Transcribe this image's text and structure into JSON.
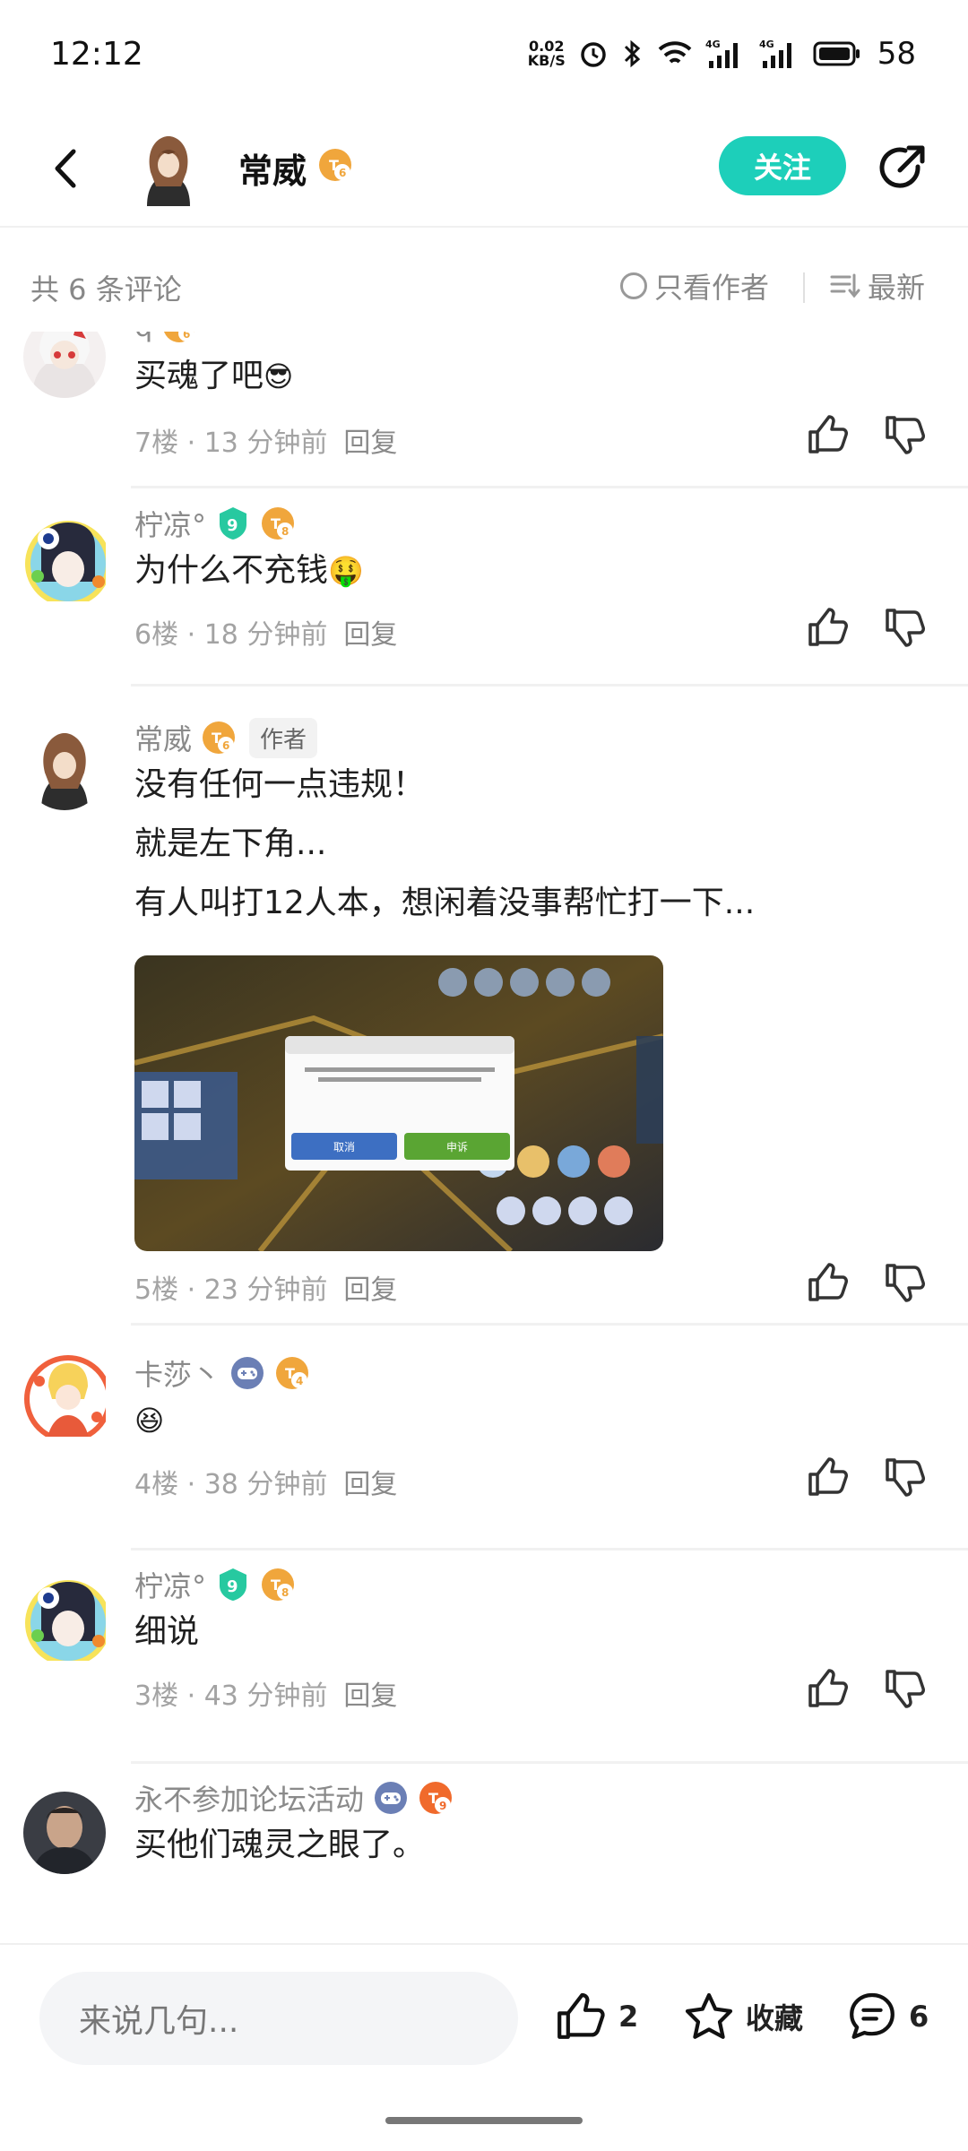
{
  "status_bar": {
    "time": "12:12",
    "net_speed_value": "0.02",
    "net_speed_unit": "KB/S",
    "battery": "58"
  },
  "header": {
    "author_name": "常威",
    "author_level": "6",
    "follow_label": "关注"
  },
  "filter": {
    "count_label": "共 6 条评论",
    "author_only_label": "只看作者",
    "sort_label": "最新"
  },
  "comments": [
    {
      "name": "q",
      "level": "6",
      "text": "买魂了吧",
      "floor_time": "7楼 · 13 分钟前",
      "reply_label": "回复"
    },
    {
      "name": "柠凉°",
      "badge": "9",
      "level": "8",
      "text": "为什么不充钱",
      "floor_time": "6楼 · 18 分钟前",
      "reply_label": "回复"
    },
    {
      "name": "常威",
      "level": "6",
      "author_tag": "作者",
      "text_lines": [
        "没有任何一点违规！",
        "就是左下角...",
        "有人叫打12人本，想闲着没事帮忙打一下..."
      ],
      "floor_time": "5楼 · 23 分钟前",
      "reply_label": "回复"
    },
    {
      "name": "卡莎丶",
      "level": "4",
      "floor_time": "4楼 · 38 分钟前",
      "reply_label": "回复"
    },
    {
      "name": "柠凉°",
      "badge": "9",
      "level": "8",
      "text": "细说",
      "floor_time": "3楼 · 43 分钟前",
      "reply_label": "回复"
    },
    {
      "name": "永不参加论坛活动",
      "level": "9",
      "text": "买他们魂灵之眼了。"
    }
  ],
  "screenshot_dialog": {
    "cancel_label": "取消",
    "confirm_label": "申诉"
  },
  "bottom_bar": {
    "input_placeholder": "来说几句...",
    "like_count": "2",
    "favorite_label": "收藏",
    "comment_count": "6"
  },
  "colors": {
    "accent": "#1dcfba",
    "level_badge": "#f0a63c",
    "badge_green": "#27c9a0",
    "text_secondary": "#8a8a8a"
  }
}
